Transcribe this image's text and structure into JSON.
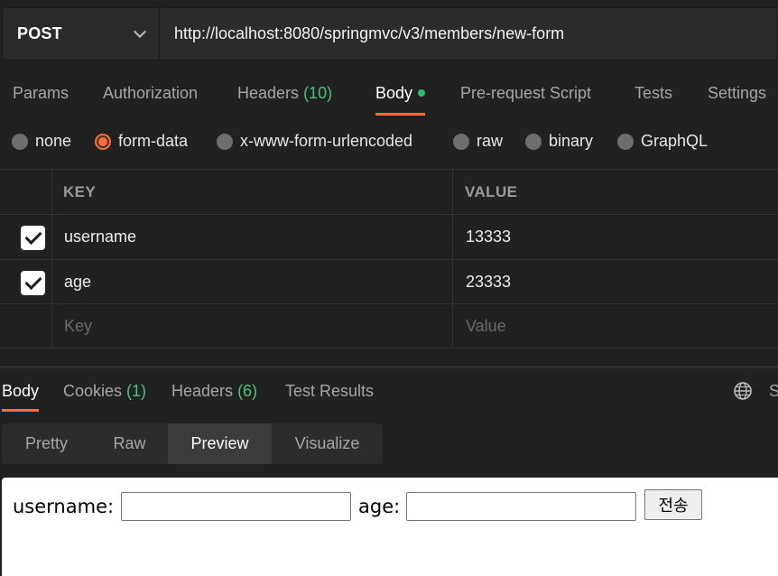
{
  "request": {
    "method": "POST",
    "url": "http://localhost:8080/springmvc/v3/members/new-form"
  },
  "request_tabs": [
    {
      "label": "Params"
    },
    {
      "label": "Authorization"
    },
    {
      "label": "Headers",
      "count": "(10)"
    },
    {
      "label": "Body",
      "active": true,
      "indicator": "dot"
    },
    {
      "label": "Pre-request Script"
    },
    {
      "label": "Tests"
    },
    {
      "label": "Settings"
    }
  ],
  "body_types": [
    {
      "label": "none",
      "selected": false
    },
    {
      "label": "form-data",
      "selected": true
    },
    {
      "label": "x-www-form-urlencoded",
      "selected": false
    },
    {
      "label": "raw",
      "selected": false
    },
    {
      "label": "binary",
      "selected": false
    },
    {
      "label": "GraphQL",
      "selected": false
    }
  ],
  "params_table": {
    "columns": [
      "KEY",
      "VALUE"
    ],
    "rows": [
      {
        "checked": true,
        "key": "username",
        "value": "13333"
      },
      {
        "checked": true,
        "key": "age",
        "value": "23333"
      }
    ],
    "empty_row": {
      "key_placeholder": "Key",
      "value_placeholder": "Value"
    }
  },
  "response_tabs": [
    {
      "label": "Body",
      "active": true
    },
    {
      "label": "Cookies",
      "count": "(1)"
    },
    {
      "label": "Headers",
      "count": "(6)"
    },
    {
      "label": "Test Results"
    }
  ],
  "response_tabs_cut": "S",
  "response_views": [
    {
      "label": "Pretty"
    },
    {
      "label": "Raw"
    },
    {
      "label": "Preview",
      "active": true
    },
    {
      "label": "Visualize"
    }
  ],
  "preview_form": {
    "username_label": "username:",
    "age_label": "age:",
    "submit_label": "전송"
  },
  "colors": {
    "accent": "#ff6c37",
    "count_green": "#49c476",
    "background": "#212121"
  },
  "icons": {
    "globe": "globe-icon",
    "dropdown": "chevron-down-icon",
    "check": "checkmark-icon"
  }
}
